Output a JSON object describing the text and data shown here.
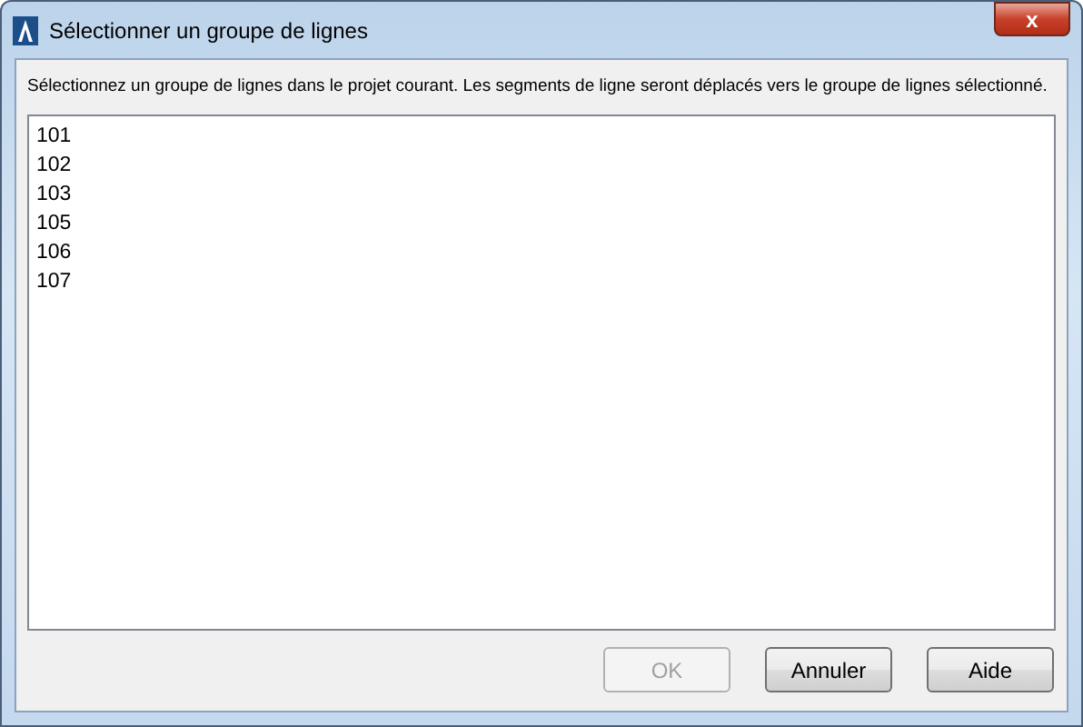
{
  "window": {
    "title": "Sélectionner un groupe de lignes",
    "close": "x"
  },
  "instruction": "Sélectionnez un groupe de lignes dans le projet courant. Les segments de ligne seront déplacés vers le groupe de lignes sélectionné.",
  "list_items": [
    {
      "label": "101",
      "selected": false
    },
    {
      "label": "102",
      "selected": false
    },
    {
      "label": "103",
      "selected": false
    },
    {
      "label": "105",
      "selected": false
    },
    {
      "label": "106",
      "selected": false
    },
    {
      "label": "107",
      "selected": false
    }
  ],
  "buttons": [
    {
      "label": "OK",
      "disabled": true
    },
    {
      "label": "Annuler",
      "disabled": false
    },
    {
      "label": "Aide",
      "disabled": false
    }
  ]
}
